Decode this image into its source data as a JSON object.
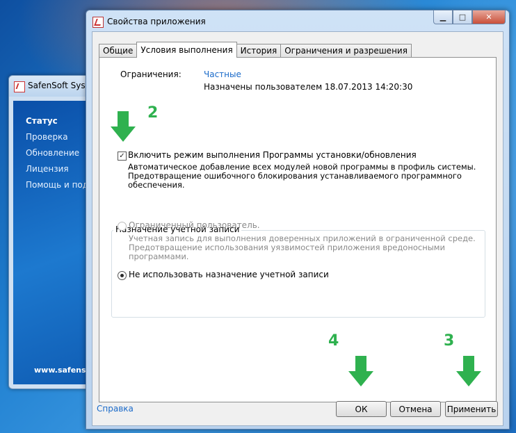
{
  "back_window": {
    "title": "SafenSoft SysW",
    "nav": [
      "Статус",
      "Проверка",
      "Обновление",
      "Лицензия",
      "Помощь и подд"
    ],
    "url": "www.safenso"
  },
  "dialog": {
    "title": "Свойства приложения",
    "tabs": [
      "Общие",
      "Условия выполнения",
      "История",
      "Ограничения и разрешения"
    ],
    "active_tab": "Условия выполнения",
    "restrictions": {
      "label": "Ограничения:",
      "value": "Частные",
      "assigned": "Назначены пользователем 18.07.2013 14:20:30"
    },
    "install_mode": {
      "label": "Включить режим выполнения Программы установки/обновления",
      "checked": true,
      "description": [
        "Автоматическое добавление всех модулей новой программы в профиль системы.",
        "Предотвращение ошибочного блокирования устанавливаемого программного",
        "обеспечения."
      ]
    },
    "account": {
      "group_title": "Назначение учетной записи",
      "limited_user": {
        "label": "Ограниченный пользователь.",
        "description": [
          "Учетная запись для выполнения доверенных приложений в ограниченной среде.",
          "Предотвращение использования уязвимостей приложения вредоносными",
          "программами."
        ]
      },
      "no_assignment": {
        "label": "Не использовать назначение учетной записи",
        "selected": true
      }
    },
    "help_link": "Справка",
    "buttons": {
      "ok": "ОК",
      "cancel": "Отмена",
      "apply": "Применить"
    }
  },
  "annotations": {
    "step_2": "2",
    "step_4": "4",
    "step_3": "3",
    "arrow_color": "#2fb14f"
  }
}
